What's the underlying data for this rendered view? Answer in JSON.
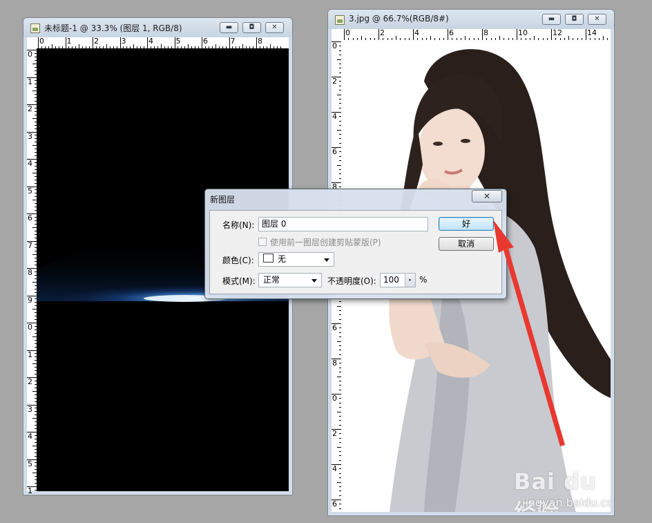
{
  "left_window": {
    "title": "未标题-1 @ 33.3% (图层 1, RGB/8)",
    "ruler_h": [
      "0",
      "1",
      "2",
      "3",
      "4",
      "5",
      "6",
      "7",
      "8"
    ],
    "ruler_v": [
      "0",
      "1",
      "2",
      "3",
      "4",
      "5",
      "6",
      "7",
      "8",
      "9",
      "0",
      "1",
      "2",
      "3",
      "4",
      "5",
      "1"
    ]
  },
  "right_window": {
    "title": "3.jpg @ 66.7%(RGB/8#)",
    "ruler_h": [
      "0",
      "2",
      "4",
      "6",
      "8",
      "10",
      "12",
      "14"
    ],
    "ruler_v": [
      "0",
      "2",
      "4",
      "6",
      "8",
      "0",
      "2",
      "4",
      "6",
      "8",
      "0",
      "2",
      "4",
      "6"
    ]
  },
  "window_buttons": {
    "minimize": "▬",
    "restore": "◘",
    "close": "✕"
  },
  "dialog": {
    "title": "新图层",
    "close_label": "✕",
    "name_label": "名称(N):",
    "name_value": "图层 0",
    "clip_checkbox_label": "使用前一图层创建剪贴蒙版(P)",
    "color_label": "颜色(C):",
    "color_value": "无",
    "mode_label": "模式(M):",
    "mode_value": "正常",
    "opacity_label": "不透明度(O):",
    "opacity_value": "100",
    "opacity_unit": "%",
    "ok_label": "好",
    "cancel_label": "取消"
  },
  "watermark": {
    "logo": "Bai du 经验",
    "url": "jingyan.baidu.com"
  },
  "colors": {
    "arrow": "#e8382f",
    "dialog_default_button": "#bfe3f8",
    "workspace": "#a6a6a6"
  }
}
